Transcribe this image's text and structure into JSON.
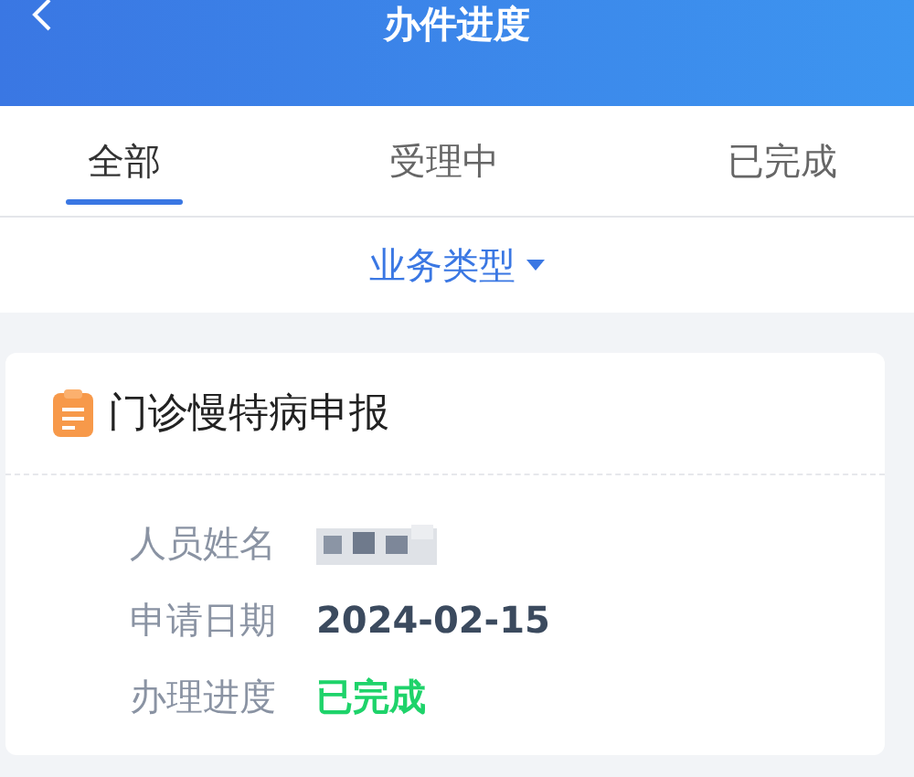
{
  "header": {
    "title": "办件进度"
  },
  "tabs": [
    {
      "label": "全部",
      "selected": true
    },
    {
      "label": "受理中",
      "selected": false
    },
    {
      "label": "已完成",
      "selected": false
    }
  ],
  "filter": {
    "label": "业务类型"
  },
  "card": {
    "title": "门诊慢特病申报",
    "fields": [
      {
        "label": "人员姓名",
        "kind": "blurred"
      },
      {
        "label": "申请日期",
        "kind": "text",
        "value": "2024-02-15"
      },
      {
        "label": "办理进度",
        "kind": "status",
        "value": "已完成",
        "color": "#1ed36a"
      }
    ]
  }
}
